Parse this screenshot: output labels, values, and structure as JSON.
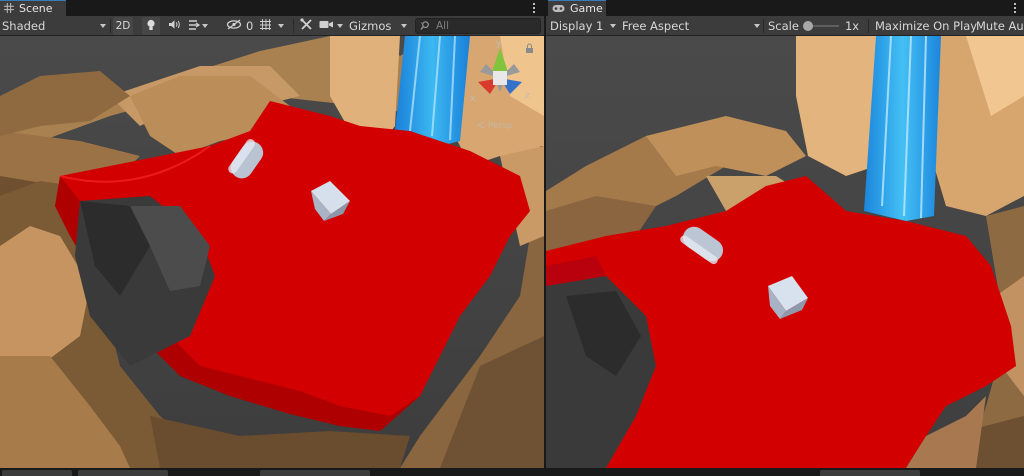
{
  "scene": {
    "tab_label": "Scene",
    "tab_icon": "grid-icon",
    "shading_mode": "Shaded",
    "view_2d_label": "2D",
    "hidden_count": "0",
    "gizmos_label": "Gizmos",
    "search": {
      "value": "",
      "placeholder": "All"
    },
    "orientation_gizmo": {
      "axis_y": "y",
      "axis_x": "x",
      "axis_z": "z",
      "projection": "Persp"
    }
  },
  "game": {
    "tab_label": "Game",
    "tab_icon": "gamepad-icon",
    "display": "Display 1",
    "aspect": "Free Aspect",
    "scale_label": "Scale",
    "scale_value": "1x",
    "scale_fraction": 0.0,
    "maximize_label": "Maximize On Play",
    "mute_label": "Mute Au"
  },
  "colors": {
    "accent_tab": "#3a79bb",
    "lava_red": "#d20000",
    "rock": "#c99a66",
    "waterfall": "#2ea3ea",
    "editor_bg": "#282828",
    "toolbar_bg": "#3c3c3c"
  }
}
